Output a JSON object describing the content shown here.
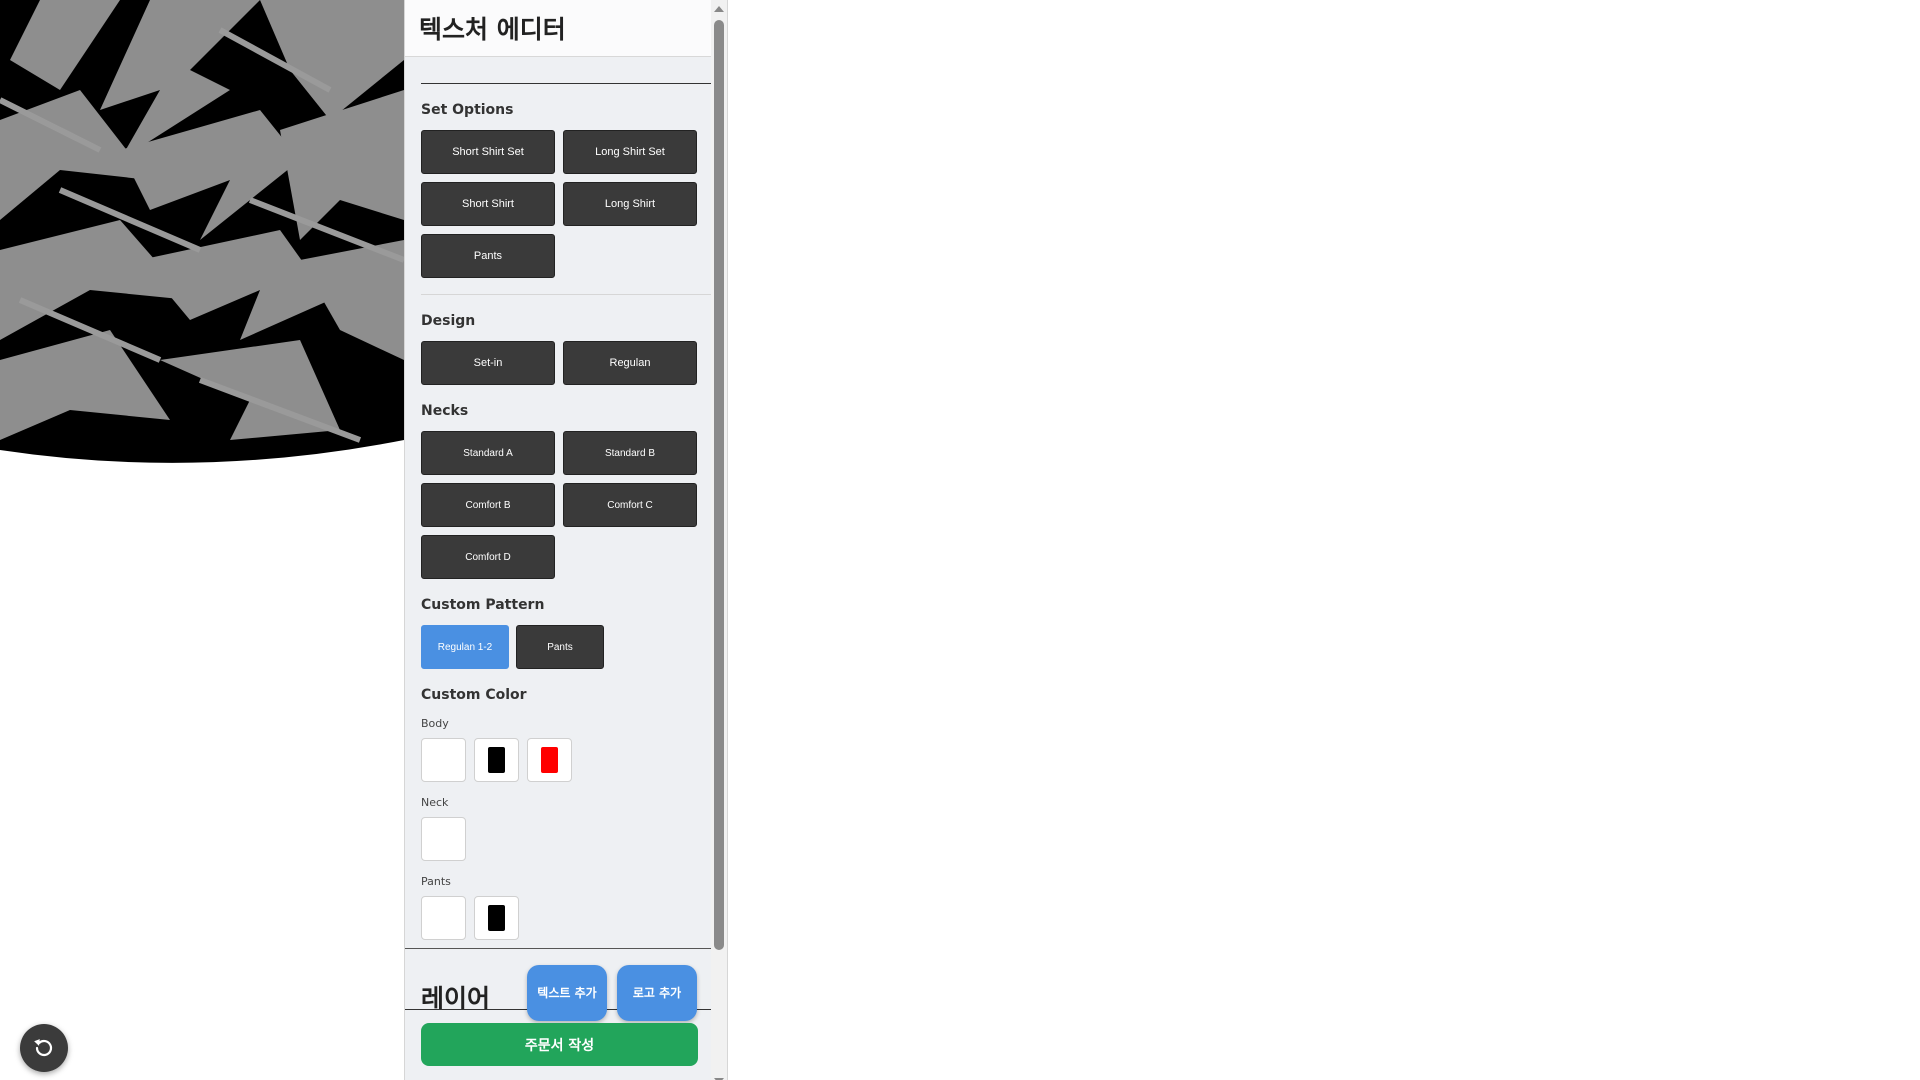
{
  "panel": {
    "title": "텍스처 에디터"
  },
  "set_options": {
    "label": "Set Options",
    "buttons": [
      "Short Shirt Set",
      "Long Shirt Set",
      "Short Shirt",
      "Long Shirt",
      "Pants"
    ]
  },
  "design": {
    "label": "Design",
    "buttons": [
      "Set-in",
      "Regulan"
    ]
  },
  "necks": {
    "label": "Necks",
    "buttons": [
      "Standard A",
      "Standard B",
      "Comfort B",
      "Comfort C",
      "Comfort D"
    ]
  },
  "custom_pattern": {
    "label": "Custom Pattern",
    "buttons": [
      "Regulan 1-2",
      "Pants"
    ],
    "selected": "Regulan 1-2"
  },
  "custom_color": {
    "label": "Custom Color",
    "body": {
      "label": "Body",
      "colors": [
        "#ffffff",
        "#000000",
        "#ff0000"
      ]
    },
    "neck": {
      "label": "Neck",
      "colors": [
        "#ffffff"
      ]
    },
    "pants": {
      "label": "Pants",
      "colors": [
        "#ffffff",
        "#000000"
      ]
    }
  },
  "layers": {
    "title": "레이어",
    "add_text": "텍스트 추가",
    "add_logo": "로고 추가"
  },
  "order_button": "주문서 작성",
  "colors": {
    "accent_blue": "#4a90e2",
    "order_green": "#22a55b",
    "button_dark": "#3a3a3a"
  },
  "icons": {
    "reset": "rotate-ccw-icon"
  }
}
